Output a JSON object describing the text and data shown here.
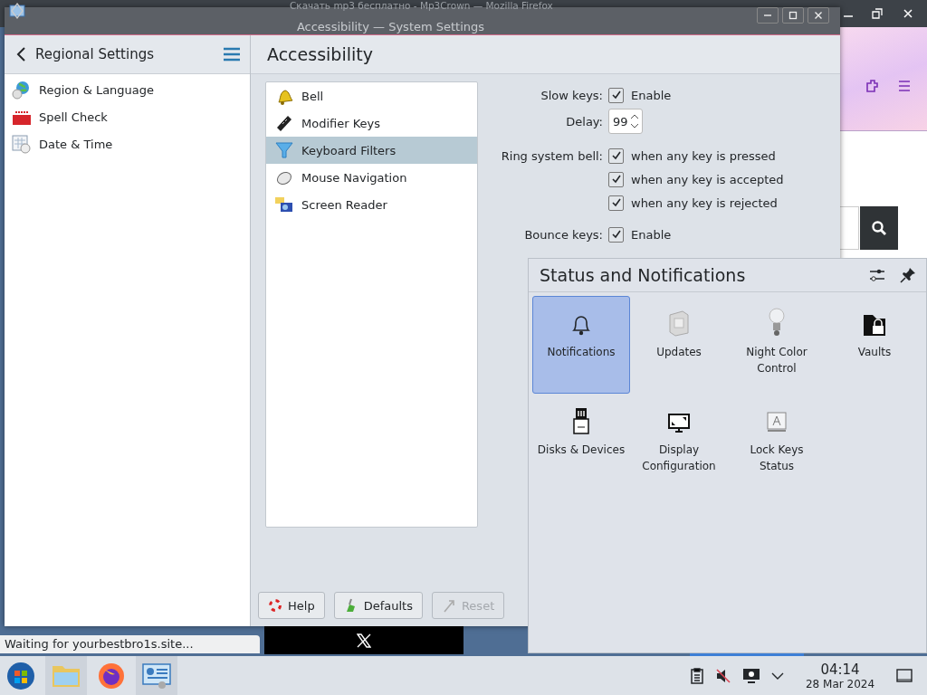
{
  "firefox": {
    "title": "Скачать mp3 бесплатно - Mp3Crown — Mozilla Firefox",
    "status": "Waiting for yourbestbro1s.site..."
  },
  "settings": {
    "title": "Accessibility — System Settings",
    "sidebar_title": "Regional Settings",
    "sidebar_items": [
      {
        "label": "Region & Language",
        "kind": "globe"
      },
      {
        "label": "Spell Check",
        "kind": "spell"
      },
      {
        "label": "Date & Time",
        "kind": "calendar"
      }
    ],
    "page_title": "Accessibility",
    "categories": [
      {
        "label": "Bell",
        "kind": "bell",
        "selected": false
      },
      {
        "label": "Modifier Keys",
        "kind": "key",
        "selected": false
      },
      {
        "label": "Keyboard Filters",
        "kind": "funnel",
        "selected": true
      },
      {
        "label": "Mouse Navigation",
        "kind": "mouse",
        "selected": false
      },
      {
        "label": "Screen Reader",
        "kind": "reader",
        "selected": false
      }
    ],
    "groups": [
      [
        {
          "kind": "checkbox",
          "label": "Slow keys:",
          "text": "Enable",
          "checked": true
        },
        {
          "kind": "spin",
          "label": "Delay:",
          "value": "99"
        }
      ],
      [
        {
          "kind": "checkbox",
          "label": "Ring system bell:",
          "text": "when any key is pressed",
          "checked": true
        },
        {
          "kind": "checkbox",
          "text": "when any key is accepted",
          "checked": true
        },
        {
          "kind": "checkbox",
          "text": "when any key is rejected",
          "checked": true
        }
      ],
      [
        {
          "kind": "checkbox",
          "label": "Bounce keys:",
          "text": "Enable",
          "checked": true
        }
      ]
    ],
    "buttons": [
      {
        "label": "Help",
        "kind": "help",
        "disabled": false
      },
      {
        "label": "Defaults",
        "kind": "defaults",
        "disabled": false
      },
      {
        "label": "Reset",
        "kind": "reset",
        "disabled": true
      }
    ]
  },
  "popup": {
    "title": "Status and Notifications",
    "items": [
      {
        "label": "Notifications",
        "kind": "bell",
        "selected": true
      },
      {
        "label": "Updates",
        "kind": "updates",
        "selected": false
      },
      {
        "label": "Night Color Control",
        "kind": "bulb",
        "selected": false
      },
      {
        "label": "Vaults",
        "kind": "vault",
        "selected": false
      },
      {
        "label": "Disks & Devices",
        "kind": "disk",
        "selected": false
      },
      {
        "label": "Display Configuration",
        "kind": "display",
        "selected": false
      },
      {
        "label": "Lock Keys Status",
        "kind": "lockkeys",
        "selected": false
      }
    ]
  },
  "taskbar": {
    "time": "04:14",
    "date": "28 Mar 2024"
  }
}
